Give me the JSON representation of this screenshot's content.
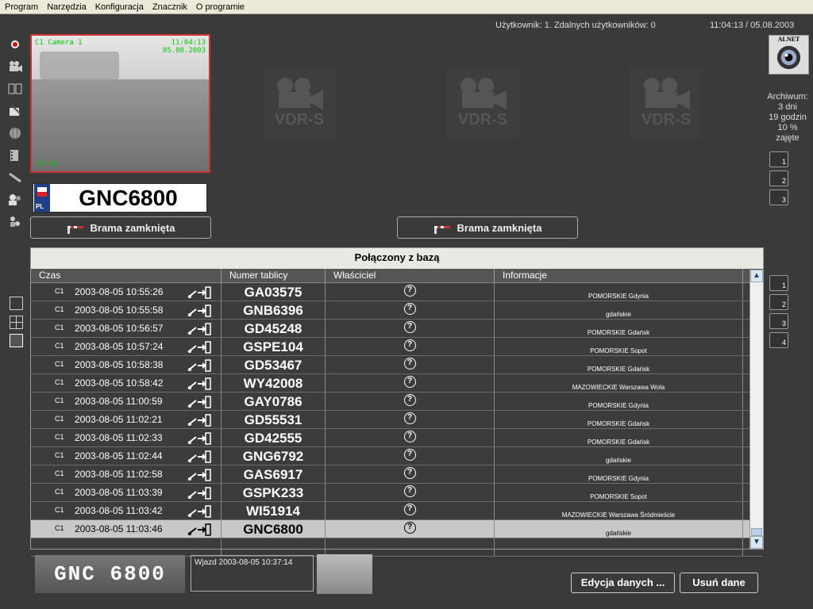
{
  "menu": [
    "Program",
    "Narzędzia",
    "Konfiguracja",
    "Znacznik",
    "O programie"
  ],
  "status": {
    "users": "Użytkownik: 1. Zdalnych użytkowników: 0",
    "datetime": "11:04:13 / 05.08.2003"
  },
  "camera": {
    "name": "C1 Camera 1",
    "time": "11:04:13",
    "date": "05.08.2003",
    "rate": "13 Hz"
  },
  "plate": {
    "country": "PL",
    "number": "GNC6800"
  },
  "vdr_label": "VDR-S",
  "gate": {
    "left": "Brama zamknięta",
    "right": "Brama zamknięta"
  },
  "logo": "ALNET",
  "archive": {
    "label": "Archiwum:",
    "days": "3 dni",
    "hours": "19 godzin",
    "percent": "10 %",
    "status": "zajęte"
  },
  "inputs": [
    "1",
    "2",
    "3"
  ],
  "outputs": [
    "1",
    "2",
    "3",
    "4"
  ],
  "panel": {
    "title": "Połączony z bazą",
    "columns": [
      "Czas",
      "Numer tablicy",
      "Właściciel",
      "Informacje"
    ],
    "owner_mark": "?",
    "rows": [
      {
        "cam": "C1",
        "time": "2003-08-05 10:55:26",
        "plate": "GA03575",
        "info": "POMORSKIE Gdynia"
      },
      {
        "cam": "C1",
        "time": "2003-08-05 10:55:58",
        "plate": "GNB6396",
        "info": "gdańskie"
      },
      {
        "cam": "C1",
        "time": "2003-08-05 10:56:57",
        "plate": "GD45248",
        "info": "POMORSKIE Gdańsk"
      },
      {
        "cam": "C1",
        "time": "2003-08-05 10:57:24",
        "plate": "GSPE104",
        "info": "POMORSKIE Sopot"
      },
      {
        "cam": "C1",
        "time": "2003-08-05 10:58:38",
        "plate": "GD53467",
        "info": "POMORSKIE Gdańsk"
      },
      {
        "cam": "C1",
        "time": "2003-08-05 10:58:42",
        "plate": "WY42008",
        "info": "MAZOWIECKIE Warszawa Wola"
      },
      {
        "cam": "C1",
        "time": "2003-08-05 11:00:59",
        "plate": "GAY0786",
        "info": "POMORSKIE Gdynia"
      },
      {
        "cam": "C1",
        "time": "2003-08-05 11:02:21",
        "plate": "GD55531",
        "info": "POMORSKIE Gdańsk"
      },
      {
        "cam": "C1",
        "time": "2003-08-05 11:02:33",
        "plate": "GD42555",
        "info": "POMORSKIE Gdańsk"
      },
      {
        "cam": "C1",
        "time": "2003-08-05 11:02:44",
        "plate": "GNG6792",
        "info": "gdańskie"
      },
      {
        "cam": "C1",
        "time": "2003-08-05 11:02:58",
        "plate": "GAS6917",
        "info": "POMORSKIE Gdynia"
      },
      {
        "cam": "C1",
        "time": "2003-08-05 11:03:39",
        "plate": "GSPK233",
        "info": "POMORSKIE Sopot"
      },
      {
        "cam": "C1",
        "time": "2003-08-05 11:03:42",
        "plate": "WI51914",
        "info": "MAZOWIECKIE Warszawa Śródmieście"
      },
      {
        "cam": "C1",
        "time": "2003-08-05 11:03:46",
        "plate": "GNC6800",
        "info": "gdańskie"
      }
    ]
  },
  "detail": {
    "snapshot_text": "GNC 6800",
    "entry": "Wjazd   2003-08-05 10:37:14"
  },
  "buttons": {
    "edit": "Edycja danych ...",
    "delete": "Usuń dane"
  }
}
